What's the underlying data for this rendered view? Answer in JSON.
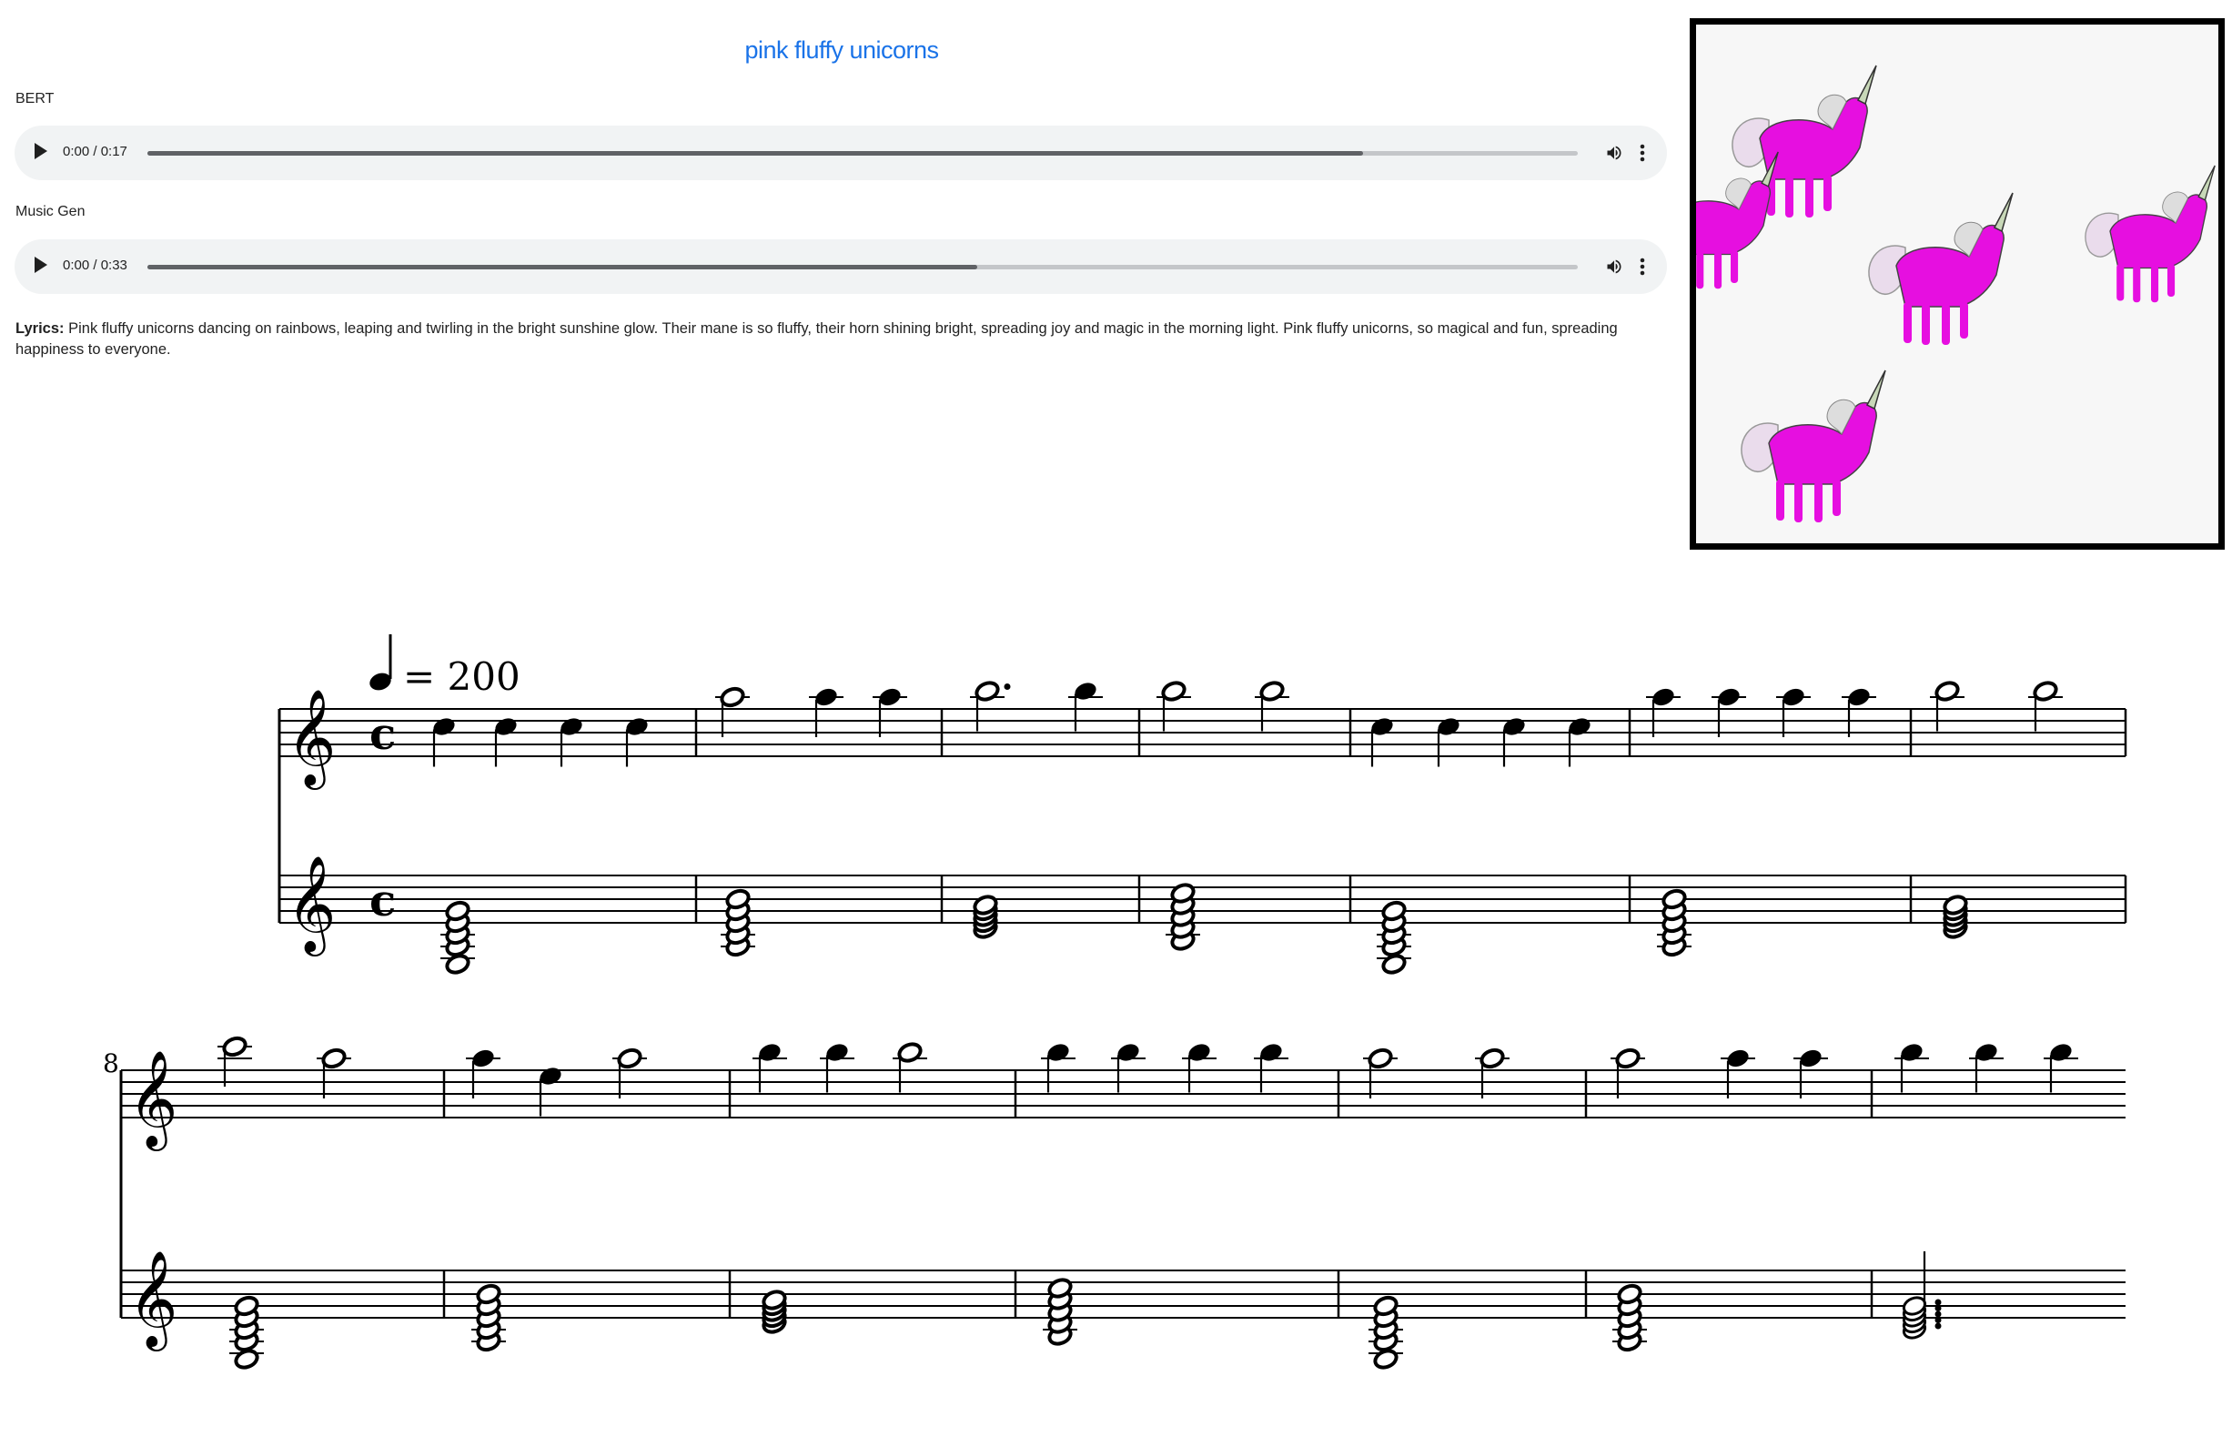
{
  "page": {
    "title": "pink fluffy unicorns"
  },
  "players": [
    {
      "label": "BERT",
      "time": "0:00 / 0:17",
      "progress": 0.85
    },
    {
      "label": "Music Gen",
      "time": "0:00 / 0:33",
      "progress": 0.58
    }
  ],
  "lyrics": {
    "label": "Lyrics:",
    "text": "Pink fluffy unicorns dancing on rainbows, leaping and twirling in the bright sunshine glow. Their mane is so fluffy, their horn shining bright, spreading joy and magic in the morning light. Pink fluffy unicorns, so magical and fun, spreading happiness to everyone."
  },
  "score": {
    "tempo_value": "= 200",
    "time_signature": "c",
    "system2_measure_number": "8"
  },
  "colors": {
    "accent": "#1a73e8",
    "unicorn": "#e60fe0",
    "player_bg": "#f1f3f4"
  },
  "icons": {
    "play": "play-icon",
    "volume": "volume-icon",
    "more": "more-vert-icon"
  }
}
